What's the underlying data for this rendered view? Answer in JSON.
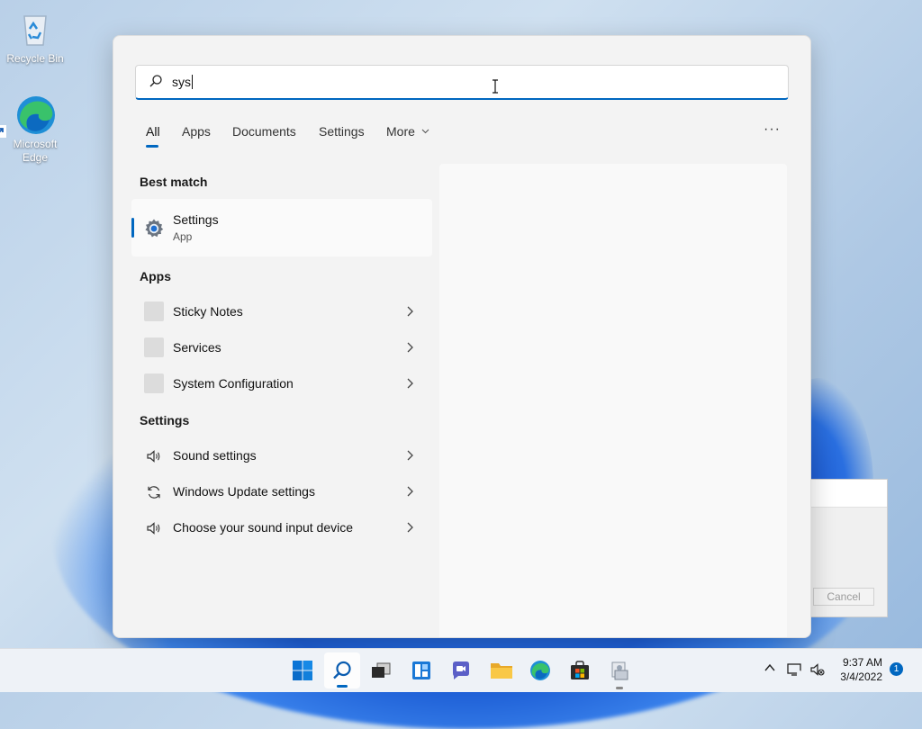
{
  "desktop": {
    "icons": [
      {
        "label": "Recycle Bin"
      },
      {
        "label": "Microsoft Edge"
      }
    ]
  },
  "background_dialog": {
    "cancel_label": "Cancel"
  },
  "search": {
    "query": "sys",
    "tabs": [
      "All",
      "Apps",
      "Documents",
      "Settings",
      "More"
    ],
    "active_tab": "All",
    "more_menu_icon": "ellipsis-icon",
    "best_match": {
      "heading": "Best match",
      "name": "Settings",
      "type": "App",
      "icon": "gear-icon"
    },
    "apps_heading": "Apps",
    "apps": [
      {
        "label": "Sticky Notes"
      },
      {
        "label": "Services"
      },
      {
        "label": "System Configuration"
      }
    ],
    "settings_heading": "Settings",
    "settings": [
      {
        "label": "Sound settings",
        "icon": "speaker-icon"
      },
      {
        "label": "Windows Update settings",
        "icon": "refresh-icon"
      },
      {
        "label": "Choose your sound input device",
        "icon": "speaker-icon"
      }
    ]
  },
  "taskbar": {
    "apps": [
      "start",
      "search",
      "task-view",
      "widgets",
      "chat",
      "file-explorer",
      "edge",
      "store",
      "app"
    ],
    "clock_time": "9:37 AM",
    "clock_date": "3/4/2022",
    "notification_count": "1"
  },
  "colors": {
    "accent": "#0067c0"
  }
}
